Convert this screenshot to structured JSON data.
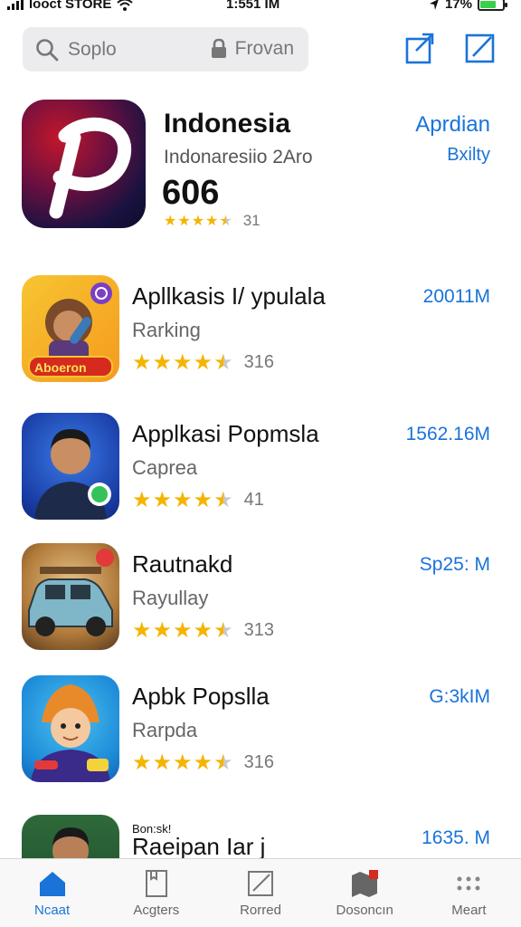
{
  "status_bar": {
    "carrier": "Iooct STORE",
    "time": "1:551 IM",
    "battery": "17%",
    "battery_level": 0.7
  },
  "search": {
    "placeholder": "Soplo",
    "right_label": "Frovan"
  },
  "featured": {
    "title": "Indonesia",
    "subtitle": "Indonaresiio 2Aro",
    "number": "606",
    "rating_stars": 4.5,
    "rating_count": "31",
    "side_label": "Aprdian",
    "side_sublabel": "Bxilty"
  },
  "apps": [
    {
      "name": "Apllkasis I/ ypulala",
      "category": "Rarking",
      "rating_stars": 4.5,
      "rating_count": "316",
      "size": "20011M",
      "icon": "sticker-character-icon",
      "badge": "Aboeron"
    },
    {
      "name": "Applkasi Popmsla",
      "category": "Caprea",
      "rating_stars": 4.5,
      "rating_count": "41",
      "size": "1562.16M",
      "icon": "person-portrait-icon"
    },
    {
      "name": "Rautnakd",
      "category": "Rayullay",
      "rating_stars": 4.5,
      "rating_count": "313",
      "size": "Sp25: M",
      "icon": "car-game-icon"
    },
    {
      "name": "Apbk Popslla",
      "category": "Rarpda",
      "rating_stars": 4.5,
      "rating_count": "316",
      "size": "G:3kIM",
      "icon": "cartoon-character-icon"
    },
    {
      "name": "Raeipan Iar j",
      "category": "",
      "rating_stars": 0,
      "rating_count": "",
      "size": "1635. M",
      "icon": "person-portrait-icon",
      "overlay": "Bon:sk!"
    }
  ],
  "tabs": [
    {
      "label": "Ncaat",
      "icon": "home-icon",
      "active": true
    },
    {
      "label": "Acgters",
      "icon": "document-icon",
      "active": false
    },
    {
      "label": "Rorred",
      "icon": "edit-square-icon",
      "active": false
    },
    {
      "label": "Dosoncın",
      "icon": "map-icon",
      "active": false
    },
    {
      "label": "Meart",
      "icon": "more-icon",
      "active": false
    }
  ],
  "colors": {
    "accent": "#1a73d9",
    "star": "#f5b400"
  }
}
